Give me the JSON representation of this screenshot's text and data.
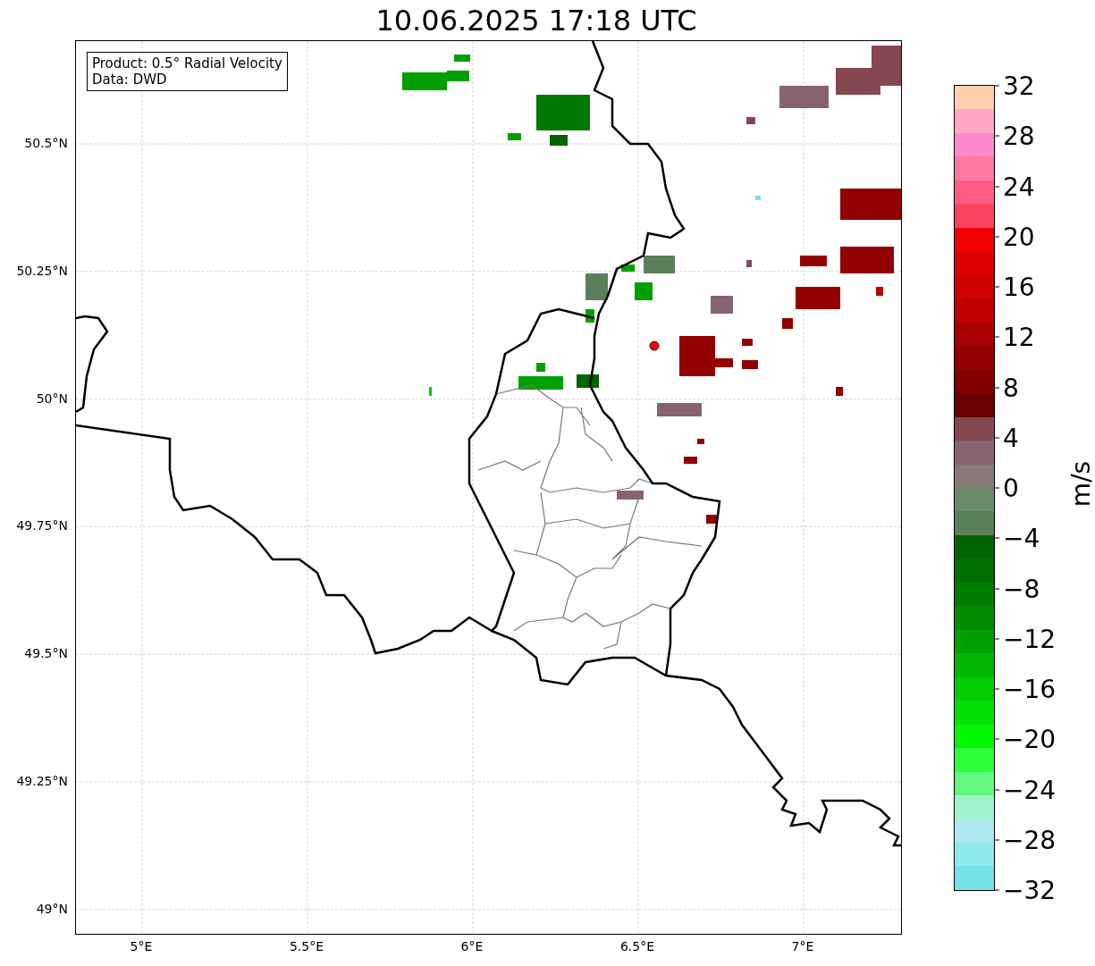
{
  "title": "10.06.2025 17:18 UTC",
  "info_box": [
    "Product: 0.5° Radial Velocity",
    "Data: DWD"
  ],
  "x_ticks": [
    "5°E",
    "5.5°E",
    "6°E",
    "6.5°E",
    "7°E"
  ],
  "y_ticks": [
    "50.5°N",
    "50.25°N",
    "50°N",
    "49.75°N",
    "49.5°N",
    "49.25°N",
    "49°N"
  ],
  "colorbar": {
    "label": "m/s",
    "ticks": [
      "32",
      "28",
      "24",
      "20",
      "16",
      "12",
      "8",
      "4",
      "0",
      "−4",
      "−8",
      "−12",
      "−16",
      "−20",
      "−24",
      "−28",
      "−32"
    ],
    "segments": [
      {
        "color": "#ffcfae"
      },
      {
        "color": "#ffa6c6"
      },
      {
        "color": "#ff88cc"
      },
      {
        "color": "#ff78a0"
      },
      {
        "color": "#fe5d86"
      },
      {
        "color": "#fc4462"
      },
      {
        "color": "#f00000"
      },
      {
        "color": "#dc0000"
      },
      {
        "color": "#cf0000"
      },
      {
        "color": "#bd0000"
      },
      {
        "color": "#a80000"
      },
      {
        "color": "#930000"
      },
      {
        "color": "#820000"
      },
      {
        "color": "#6a0000"
      },
      {
        "color": "#864850"
      },
      {
        "color": "#856470"
      },
      {
        "color": "#877b78"
      },
      {
        "color": "#6b8a6b"
      },
      {
        "color": "#5a7f5a"
      },
      {
        "color": "#006400"
      },
      {
        "color": "#006e00"
      },
      {
        "color": "#007c00"
      },
      {
        "color": "#008c00"
      },
      {
        "color": "#00a000"
      },
      {
        "color": "#00b700"
      },
      {
        "color": "#00cc00"
      },
      {
        "color": "#00e000"
      },
      {
        "color": "#00f800"
      },
      {
        "color": "#2ffe3a"
      },
      {
        "color": "#63f87f"
      },
      {
        "color": "#9ef4cc"
      },
      {
        "color": "#ade9ee"
      },
      {
        "color": "#8ee9ec"
      },
      {
        "color": "#73e3e8"
      }
    ]
  }
}
